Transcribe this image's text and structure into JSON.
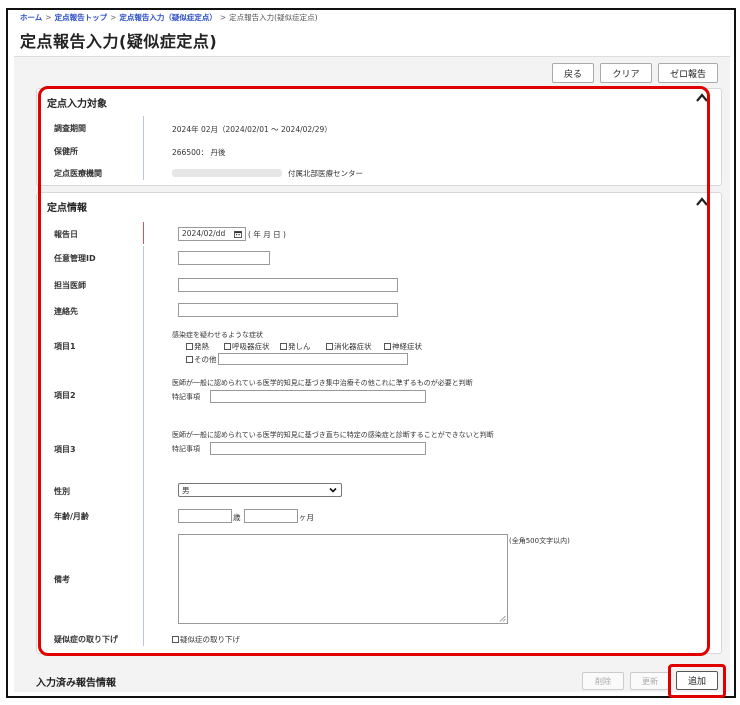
{
  "breadcrumb": {
    "items": [
      "ホーム",
      "定点報告トップ",
      "定点報告入力（疑似症定点）"
    ],
    "current": "定点報告入力(疑似症定点)"
  },
  "page_title": "定点報告入力(疑似症定点)",
  "toolbar": {
    "back": "戻る",
    "clear": "クリア",
    "zero_report": "ゼロ報告"
  },
  "target_section": {
    "title": "定点入力対象",
    "rows": [
      {
        "label": "調査期間",
        "value": "2024年 02月（2024/02/01 ～ 2024/02/29）"
      },
      {
        "label": "保健所",
        "value": "266500： 丹後"
      },
      {
        "label": "定点医療機関",
        "value": "付属北部医療センター"
      }
    ]
  },
  "info_section": {
    "title": "定点情報",
    "report_date": {
      "label": "報告日",
      "value": "2024/02/dd",
      "suffix": "( 年 月 日 )"
    },
    "management_id": {
      "label": "任意管理ID",
      "value": ""
    },
    "doctor": {
      "label": "担当医師",
      "value": ""
    },
    "contact": {
      "label": "連絡先",
      "value": ""
    },
    "item1": {
      "label": "項目1",
      "intro": "感染症を疑わせるような症状",
      "options": [
        "発熱",
        "呼吸器症状",
        "発しん",
        "消化器症状",
        "神経症状"
      ],
      "other": "その他"
    },
    "item2": {
      "label": "項目2",
      "intro": "医師が一般に認められている医学的知見に基づき集中治療その他これに準ずるものが必要と判断",
      "note_label": "特記事項"
    },
    "item3": {
      "label": "項目3",
      "intro": "医師が一般に認められている医学的知見に基づき直ちに特定の感染症と診断することができないと判断",
      "note_label": "特記事項"
    },
    "sex": {
      "label": "性別",
      "value": "男"
    },
    "age": {
      "label": "年齢/月齢",
      "years_unit": "歳",
      "months_unit": "ヶ月"
    },
    "remarks": {
      "label": "備考",
      "hint": "(全角500文字以内)"
    },
    "withdraw": {
      "label": "疑似症の取り下げ",
      "option": "疑似症の取り下げ"
    }
  },
  "submitted_section": {
    "title": "入力済み報告情報",
    "delete": "削除",
    "update": "更新",
    "add": "追加"
  }
}
